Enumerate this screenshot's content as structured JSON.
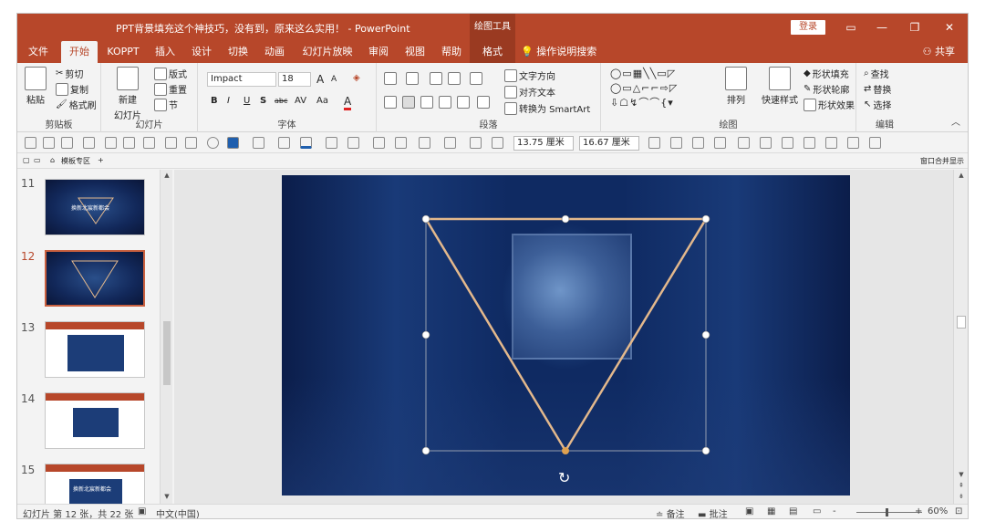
{
  "window": {
    "title": "PPT背景填充这个神技巧，没有到，原来这么实用！ - PowerPoint",
    "context_tools": "绘图工具",
    "login": "登录",
    "accent": "#b7472a"
  },
  "tabs": [
    {
      "label": "文件"
    },
    {
      "label": "开始"
    },
    {
      "label": "KOPPT"
    },
    {
      "label": "插入"
    },
    {
      "label": "设计"
    },
    {
      "label": "切换"
    },
    {
      "label": "动画"
    },
    {
      "label": "幻灯片放映"
    },
    {
      "label": "审阅"
    },
    {
      "label": "视图"
    },
    {
      "label": "帮助"
    },
    {
      "label": "格式"
    }
  ],
  "tell_me": "操作说明搜索",
  "share": "共享",
  "ribbon": {
    "clipboard": {
      "label": "剪贴板",
      "paste": "粘贴",
      "cut": "剪切",
      "copy": "复制",
      "format_painter": "格式刷"
    },
    "slides": {
      "label": "幻灯片",
      "new_slide": "新建",
      "new_slide2": "幻灯片",
      "layout": "版式",
      "reset": "重置",
      "section": "节"
    },
    "font": {
      "label": "字体",
      "font_name": "Impact",
      "font_size": "18",
      "aa_big": "A",
      "aa_small": "A",
      "bold": "B",
      "italic": "I",
      "underline": "U",
      "shadow": "S",
      "strike": "abc",
      "spacing": "AV",
      "case": "Aa",
      "color": "A"
    },
    "paragraph": {
      "label": "段落",
      "text_direction": "文字方向",
      "align_text": "对齐文本",
      "smartart": "转换为 SmartArt"
    },
    "drawing": {
      "label": "绘图",
      "arrange": "排列",
      "quick_styles": "快速样式",
      "fill": "形状填充",
      "outline": "形状轮廓",
      "effects": "形状效果"
    },
    "editing": {
      "label": "编辑",
      "find": "查找",
      "replace": "替换",
      "select": "选择"
    }
  },
  "qat": {
    "width": "13.75 厘米",
    "height": "16.67 厘米"
  },
  "doc_tab": "模板专区",
  "doc_right": "窗口合并显示",
  "slides": [
    {
      "num": "11",
      "theme": "dark",
      "caption": "换新北宸新都会"
    },
    {
      "num": "12",
      "theme": "dark",
      "caption": ""
    },
    {
      "num": "13",
      "theme": "light",
      "caption": ""
    },
    {
      "num": "14",
      "theme": "light",
      "caption": ""
    },
    {
      "num": "15",
      "theme": "light",
      "caption": "换新北宸新都会"
    }
  ],
  "selected_slide": "12",
  "status": {
    "slide_info": "幻灯片 第 12 张，共 22 张",
    "language": "中文(中国)",
    "notes": "备注",
    "comments": "批注",
    "zoom": "60%",
    "zoom_minus": "-",
    "zoom_plus": "+"
  },
  "shape": {
    "stroke": "#e3b88c",
    "handle_color": "#ffffff",
    "handle_bottom": "#e0a150"
  }
}
